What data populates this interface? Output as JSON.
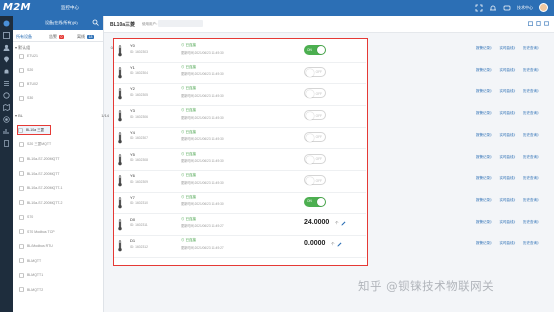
{
  "app": {
    "logo": "M2M",
    "title": "监控中心",
    "user_name": "技术中心"
  },
  "sidebar": {
    "header_title": "设备(在线/所有)(6)",
    "tabs": [
      {
        "label": "所有设备"
      },
      {
        "label": "告警",
        "badge": "0",
        "badge_color": "#e53935"
      },
      {
        "label": "离线",
        "badge": "18",
        "badge_color": "#2c6fb5"
      }
    ],
    "groups": [
      {
        "label": "默认组",
        "count": "0/5"
      },
      {
        "label": "BL",
        "count": "1/14"
      }
    ],
    "devices_default": [
      "ETU21",
      "S20",
      "BTU02",
      "S30"
    ],
    "devices_bl": [
      "BL10a 三菱",
      "S20 三菱MQTT",
      "BL10a-S7-200MQTT",
      "BL10a-S7-200MQTT",
      "BL10a-S7-200MQTT-1",
      "BL10a-S7-200MQTT-2",
      "S70",
      "S70 Modbus TCP",
      "BL/Modbus RTU",
      "BLMQTT",
      "BLMQTT1",
      "BLMQTT2"
    ]
  },
  "main": {
    "device_title": "BL10a三菱",
    "user_label": "使用用户："
  },
  "sensors": [
    {
      "name": "Y0",
      "id": "ID: 1602303",
      "status": "已连接",
      "updated": "更新时间:2021/06/23 11:49:30",
      "kind": "switch",
      "state": "on",
      "state_label": "ON"
    },
    {
      "name": "Y1",
      "id": "ID: 1602304",
      "status": "已连接",
      "updated": "更新时间:2021/06/23 11:49:30",
      "kind": "switch",
      "state": "off",
      "state_label": "OFF"
    },
    {
      "name": "Y2",
      "id": "ID: 1602305",
      "status": "已连接",
      "updated": "更新时间:2021/06/23 11:49:30",
      "kind": "switch",
      "state": "off",
      "state_label": "OFF"
    },
    {
      "name": "Y3",
      "id": "ID: 1602306",
      "status": "已连接",
      "updated": "更新时间:2021/06/23 11:49:30",
      "kind": "switch",
      "state": "off",
      "state_label": "OFF"
    },
    {
      "name": "Y4",
      "id": "ID: 1602307",
      "status": "已连接",
      "updated": "更新时间:2021/06/23 11:49:30",
      "kind": "switch",
      "state": "off",
      "state_label": "OFF"
    },
    {
      "name": "Y5",
      "id": "ID: 1602308",
      "status": "已连接",
      "updated": "更新时间:2021/06/23 11:49:30",
      "kind": "switch",
      "state": "off",
      "state_label": "OFF"
    },
    {
      "name": "Y6",
      "id": "ID: 1602309",
      "status": "已连接",
      "updated": "更新时间:2021/06/23 11:49:30",
      "kind": "switch",
      "state": "off",
      "state_label": "OFF"
    },
    {
      "name": "Y7",
      "id": "ID: 1602310",
      "status": "已连接",
      "updated": "更新时间:2021/06/23 11:49:30",
      "kind": "switch",
      "state": "on",
      "state_label": "ON"
    },
    {
      "name": "D0",
      "id": "ID: 1602311",
      "status": "已连接",
      "updated": "更新时间:2021/06/23 11:49:27",
      "kind": "value",
      "value": "24.0000",
      "unit": "个"
    },
    {
      "name": "D1",
      "id": "ID: 1602312",
      "status": "已连接",
      "updated": "更新时间:2021/06/23 11:49:27",
      "kind": "value",
      "value": "0.0000",
      "unit": "个"
    }
  ],
  "row_actions": [
    "报警记录》",
    "实时曲线》",
    "历史查询》"
  ],
  "watermark": "知乎 @钡铼技术物联网关",
  "colors": {
    "brand": "#2c6fb5",
    "highlight": "#e53935",
    "connected": "#43a047",
    "toggle_on": "#4caf50"
  }
}
